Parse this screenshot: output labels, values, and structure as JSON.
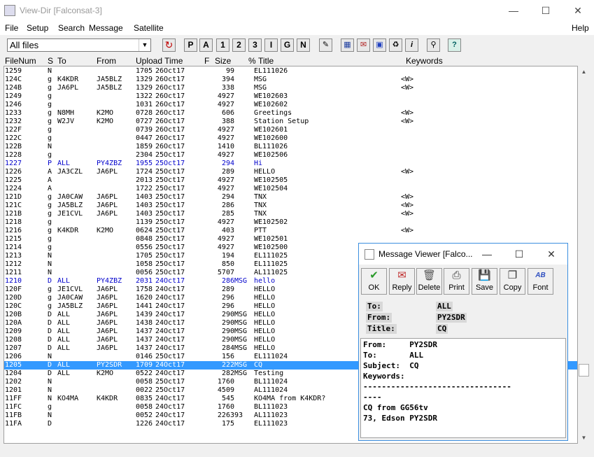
{
  "window": {
    "title": "View-Dir [Falconsat-3]",
    "minimize": "—",
    "maximize": "☐",
    "close": "✕"
  },
  "menu": [
    "File",
    "Setup",
    "Search",
    "Message",
    "Satellite"
  ],
  "help": "Help",
  "filter": {
    "value": "All files",
    "arrow": "▼"
  },
  "toolbar_letters": [
    "P",
    "A",
    "1",
    "2",
    "3",
    "I",
    "G",
    "N"
  ],
  "columns": {
    "filenum": "FileNum",
    "s": "S",
    "to": "To",
    "from": "From",
    "upload": "Upload Time",
    "f": "F",
    "size": "Size",
    "pct": "%",
    "title": "Title",
    "keywords": "Keywords"
  },
  "rows": [
    {
      "num": "1259",
      "s": "N",
      "to": "",
      "from": "",
      "time": "1705",
      "date": "26Oct17",
      "f": "",
      "size": "99",
      "pct": "",
      "title": "EL111026",
      "kw": "",
      "style": ""
    },
    {
      "num": "124C",
      "s": "g",
      "to": "K4KDR",
      "from": "JA5BLZ",
      "time": "1329",
      "date": "26Oct17",
      "f": "",
      "size": "394",
      "pct": "",
      "title": "MSG",
      "kw": "<W>",
      "style": ""
    },
    {
      "num": "124B",
      "s": "g",
      "to": "JA6PL",
      "from": "JA5BLZ",
      "time": "1329",
      "date": "26Oct17",
      "f": "",
      "size": "338",
      "pct": "",
      "title": "MSG",
      "kw": "<W>",
      "style": ""
    },
    {
      "num": "1249",
      "s": "g",
      "to": "",
      "from": "",
      "time": "1322",
      "date": "26Oct17",
      "f": "",
      "size": "4927",
      "pct": "",
      "title": "WE102603",
      "kw": "",
      "style": ""
    },
    {
      "num": "1246",
      "s": "g",
      "to": "",
      "from": "",
      "time": "1031",
      "date": "26Oct17",
      "f": "",
      "size": "4927",
      "pct": "",
      "title": "WE102602",
      "kw": "",
      "style": ""
    },
    {
      "num": "1233",
      "s": "g",
      "to": "N8MH",
      "from": "K2MO",
      "time": "0728",
      "date": "26Oct17",
      "f": "",
      "size": "606",
      "pct": "",
      "title": "Greetings",
      "kw": "<W>",
      "style": ""
    },
    {
      "num": "1232",
      "s": "g",
      "to": "W2JV",
      "from": "K2MO",
      "time": "0727",
      "date": "26Oct17",
      "f": "",
      "size": "388",
      "pct": "",
      "title": "Station Setup",
      "kw": "<W>",
      "style": ""
    },
    {
      "num": "122F",
      "s": "g",
      "to": "",
      "from": "",
      "time": "0739",
      "date": "26Oct17",
      "f": "",
      "size": "4927",
      "pct": "",
      "title": "WE102601",
      "kw": "",
      "style": ""
    },
    {
      "num": "122C",
      "s": "g",
      "to": "",
      "from": "",
      "time": "0447",
      "date": "26Oct17",
      "f": "",
      "size": "4927",
      "pct": "",
      "title": "WE102600",
      "kw": "",
      "style": ""
    },
    {
      "num": "122B",
      "s": "N",
      "to": "",
      "from": "",
      "time": "1859",
      "date": "26Oct17",
      "f": "",
      "size": "1410",
      "pct": "",
      "title": "BL111026",
      "kw": "",
      "style": ""
    },
    {
      "num": "1228",
      "s": "g",
      "to": "",
      "from": "",
      "time": "2304",
      "date": "25Oct17",
      "f": "",
      "size": "4927",
      "pct": "",
      "title": "WE102506",
      "kw": "",
      "style": ""
    },
    {
      "num": "1227",
      "s": "P",
      "to": "ALL",
      "from": "PY4ZBZ",
      "time": "1955",
      "date": "25Oct17",
      "f": "",
      "size": "294",
      "pct": "",
      "title": "Hi",
      "kw": "",
      "style": "blue"
    },
    {
      "num": "1226",
      "s": "A",
      "to": "JA3CZL",
      "from": "JA6PL",
      "time": "1724",
      "date": "25Oct17",
      "f": "",
      "size": "289",
      "pct": "",
      "title": "HELLO",
      "kw": "<W>",
      "style": ""
    },
    {
      "num": "1225",
      "s": "A",
      "to": "",
      "from": "",
      "time": "2013",
      "date": "25Oct17",
      "f": "",
      "size": "4927",
      "pct": "",
      "title": "WE102505",
      "kw": "",
      "style": ""
    },
    {
      "num": "1224",
      "s": "A",
      "to": "",
      "from": "",
      "time": "1722",
      "date": "25Oct17",
      "f": "",
      "size": "4927",
      "pct": "",
      "title": "WE102504",
      "kw": "",
      "style": ""
    },
    {
      "num": "121D",
      "s": "g",
      "to": "JA0CAW",
      "from": "JA6PL",
      "time": "1403",
      "date": "25Oct17",
      "f": "",
      "size": "294",
      "pct": "",
      "title": "TNX",
      "kw": "<W>",
      "style": ""
    },
    {
      "num": "121C",
      "s": "g",
      "to": "JA5BLZ",
      "from": "JA6PL",
      "time": "1403",
      "date": "25Oct17",
      "f": "",
      "size": "286",
      "pct": "",
      "title": "TNX",
      "kw": "<W>",
      "style": ""
    },
    {
      "num": "121B",
      "s": "g",
      "to": "JE1CVL",
      "from": "JA6PL",
      "time": "1403",
      "date": "25Oct17",
      "f": "",
      "size": "285",
      "pct": "",
      "title": "TNX",
      "kw": "<W>",
      "style": ""
    },
    {
      "num": "1218",
      "s": "g",
      "to": "",
      "from": "",
      "time": "1139",
      "date": "25Oct17",
      "f": "",
      "size": "4927",
      "pct": "",
      "title": "WE102502",
      "kw": "",
      "style": ""
    },
    {
      "num": "1216",
      "s": "g",
      "to": "K4KDR",
      "from": "K2MO",
      "time": "0624",
      "date": "25Oct17",
      "f": "",
      "size": "403",
      "pct": "",
      "title": "PTT",
      "kw": "<W>",
      "style": ""
    },
    {
      "num": "1215",
      "s": "g",
      "to": "",
      "from": "",
      "time": "0848",
      "date": "25Oct17",
      "f": "",
      "size": "4927",
      "pct": "",
      "title": "WE102501",
      "kw": "",
      "style": ""
    },
    {
      "num": "1214",
      "s": "g",
      "to": "",
      "from": "",
      "time": "0556",
      "date": "25Oct17",
      "f": "",
      "size": "4927",
      "pct": "",
      "title": "WE102500",
      "kw": "",
      "style": ""
    },
    {
      "num": "1213",
      "s": "N",
      "to": "",
      "from": "",
      "time": "1705",
      "date": "25Oct17",
      "f": "",
      "size": "194",
      "pct": "",
      "title": "EL111025",
      "kw": "",
      "style": ""
    },
    {
      "num": "1212",
      "s": "N",
      "to": "",
      "from": "",
      "time": "1058",
      "date": "25Oct17",
      "f": "",
      "size": "850",
      "pct": "",
      "title": "EL111025",
      "kw": "",
      "style": ""
    },
    {
      "num": "1211",
      "s": "N",
      "to": "",
      "from": "",
      "time": "0056",
      "date": "25Oct17",
      "f": "",
      "size": "5707",
      "pct": "",
      "title": "AL111025",
      "kw": "",
      "style": ""
    },
    {
      "num": "1210",
      "s": "D",
      "to": "ALL",
      "from": "PY4ZBZ",
      "time": "2031",
      "date": "24Oct17",
      "f": "",
      "size": "286",
      "pct": "MSG",
      "title": "hello",
      "kw": "",
      "style": "blue"
    },
    {
      "num": "120F",
      "s": "g",
      "to": "JE1CVL",
      "from": "JA6PL",
      "time": "1758",
      "date": "24Oct17",
      "f": "",
      "size": "289",
      "pct": "",
      "title": "HELLO",
      "kw": "",
      "style": ""
    },
    {
      "num": "120D",
      "s": "g",
      "to": "JA0CAW",
      "from": "JA6PL",
      "time": "1620",
      "date": "24Oct17",
      "f": "",
      "size": "296",
      "pct": "",
      "title": "HELLO",
      "kw": "",
      "style": ""
    },
    {
      "num": "120C",
      "s": "g",
      "to": "JA5BLZ",
      "from": "JA6PL",
      "time": "1441",
      "date": "24Oct17",
      "f": "",
      "size": "296",
      "pct": "",
      "title": "HELLO",
      "kw": "",
      "style": ""
    },
    {
      "num": "120B",
      "s": "D",
      "to": "ALL",
      "from": "JA6PL",
      "time": "1439",
      "date": "24Oct17",
      "f": "",
      "size": "290",
      "pct": "MSG",
      "title": "HELLO",
      "kw": "",
      "style": ""
    },
    {
      "num": "120A",
      "s": "D",
      "to": "ALL",
      "from": "JA6PL",
      "time": "1438",
      "date": "24Oct17",
      "f": "",
      "size": "290",
      "pct": "MSG",
      "title": "HELLO",
      "kw": "",
      "style": ""
    },
    {
      "num": "1209",
      "s": "D",
      "to": "ALL",
      "from": "JA6PL",
      "time": "1437",
      "date": "24Oct17",
      "f": "",
      "size": "290",
      "pct": "MSG",
      "title": "HELLO",
      "kw": "",
      "style": ""
    },
    {
      "num": "1208",
      "s": "D",
      "to": "ALL",
      "from": "JA6PL",
      "time": "1437",
      "date": "24Oct17",
      "f": "",
      "size": "290",
      "pct": "MSG",
      "title": "HELLO",
      "kw": "",
      "style": ""
    },
    {
      "num": "1207",
      "s": "D",
      "to": "ALL",
      "from": "JA6PL",
      "time": "1437",
      "date": "24Oct17",
      "f": "",
      "size": "284",
      "pct": "MSG",
      "title": "HELLO",
      "kw": "",
      "style": ""
    },
    {
      "num": "1206",
      "s": "N",
      "to": "",
      "from": "",
      "time": "0146",
      "date": "25Oct17",
      "f": "",
      "size": "156",
      "pct": "",
      "title": "EL111024",
      "kw": "",
      "style": ""
    },
    {
      "num": "1205",
      "s": "D",
      "to": "ALL",
      "from": "PY2SDR",
      "time": "1709",
      "date": "24Oct17",
      "f": "",
      "size": "222",
      "pct": "MSG",
      "title": "CQ",
      "kw": "",
      "style": "sel"
    },
    {
      "num": "1204",
      "s": "D",
      "to": "ALL",
      "from": "K2MO",
      "time": "0522",
      "date": "24Oct17",
      "f": "",
      "size": "282",
      "pct": "MSG",
      "title": "Testing",
      "kw": "",
      "style": ""
    },
    {
      "num": "1202",
      "s": "N",
      "to": "",
      "from": "",
      "time": "0058",
      "date": "25Oct17",
      "f": "",
      "size": "1760",
      "pct": "",
      "title": "BL111024",
      "kw": "",
      "style": ""
    },
    {
      "num": "1201",
      "s": "N",
      "to": "",
      "from": "",
      "time": "0022",
      "date": "25Oct17",
      "f": "",
      "size": "4509",
      "pct": "",
      "title": "AL111024",
      "kw": "",
      "style": ""
    },
    {
      "num": "11FF",
      "s": "N",
      "to": "KO4MA",
      "from": "K4KDR",
      "time": "0835",
      "date": "24Oct17",
      "f": "",
      "size": "545",
      "pct": "",
      "title": "KO4MA from K4KDR?",
      "kw": "",
      "style": ""
    },
    {
      "num": "11FC",
      "s": "g",
      "to": "",
      "from": "",
      "time": "0058",
      "date": "24Oct17",
      "f": "",
      "size": "1760",
      "pct": "",
      "title": "BL111023",
      "kw": "",
      "style": ""
    },
    {
      "num": "11FB",
      "s": "N",
      "to": "",
      "from": "",
      "time": "0052",
      "date": "24Oct17",
      "f": "",
      "size": "2263",
      "pct": "93",
      "title": "AL111023",
      "kw": "",
      "style": ""
    },
    {
      "num": "11FA",
      "s": "D",
      "to": "",
      "from": "",
      "time": "1226",
      "date": "24Oct17",
      "f": "",
      "size": "175",
      "pct": "",
      "title": "EL111023",
      "kw": "",
      "style": ""
    }
  ],
  "scroll": {
    "up": "▲",
    "down": "▼"
  },
  "viewer": {
    "title": "Message Viewer [Falco...",
    "minimize": "—",
    "maximize": "☐",
    "close": "✕",
    "buttons": [
      {
        "label": "OK",
        "glyph": "✔",
        "color": "#2a9a2a"
      },
      {
        "label": "Reply",
        "glyph": "✉",
        "color": "#c03030"
      },
      {
        "label": "Delete",
        "glyph": "🗑",
        "color": "#555555"
      },
      {
        "label": "Print",
        "glyph": "⎙",
        "color": "#333333"
      },
      {
        "label": "Save",
        "glyph": "💾",
        "color": "#2040c0"
      },
      {
        "label": "Copy",
        "glyph": "❐",
        "color": "#333333"
      },
      {
        "label": "Font",
        "glyph": "AB",
        "color": "#3050c0"
      }
    ],
    "header": {
      "to_label": "To:",
      "to": "ALL",
      "from_label": "From:",
      "from": "PY2SDR",
      "title_label": "Title:",
      "title": "CQ"
    },
    "body": "From:     PY2SDR\nTo:       ALL\nSubject:  CQ\nKeywords:\n--------------------------------\n----\nCQ from GG56tv\n73, Edson PY2SDR"
  }
}
